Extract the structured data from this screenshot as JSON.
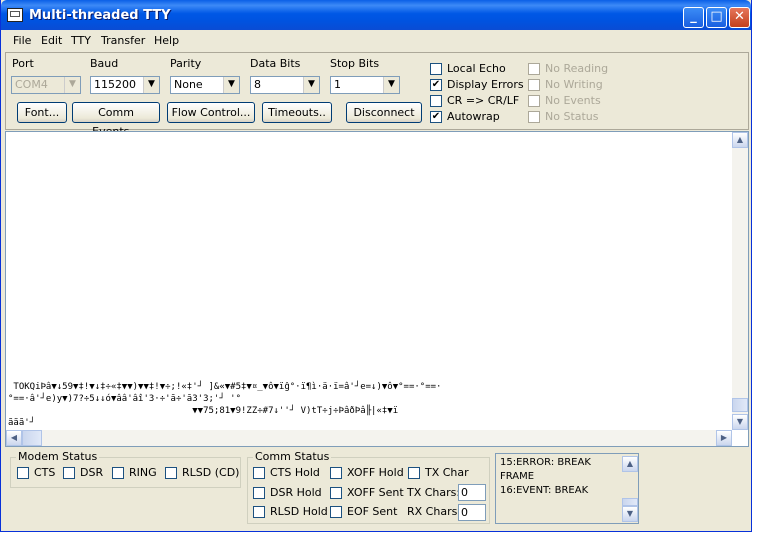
{
  "window": {
    "title": "Multi-threaded TTY",
    "controls": {
      "minimize": "_",
      "maximize": "□",
      "close": "✕"
    }
  },
  "menu": [
    "File",
    "Edit",
    "TTY",
    "Transfer",
    "Help"
  ],
  "settings": {
    "port": {
      "label": "Port",
      "value": "COM4"
    },
    "baud": {
      "label": "Baud",
      "value": "115200"
    },
    "parity": {
      "label": "Parity",
      "value": "None"
    },
    "data_bits": {
      "label": "Data Bits",
      "value": "8"
    },
    "stop_bits": {
      "label": "Stop Bits",
      "value": "1"
    },
    "buttons": {
      "font": "Font...",
      "comm_events": "Comm Events...",
      "flow_control": "Flow Control...",
      "timeouts": "Timeouts..",
      "disconnect": "Disconnect"
    },
    "options": [
      {
        "label": "Local Echo",
        "checked": false,
        "enabled": true
      },
      {
        "label": "Display Errors",
        "checked": true,
        "enabled": true
      },
      {
        "label": "CR => CR/LF",
        "checked": false,
        "enabled": true
      },
      {
        "label": "Autowrap",
        "checked": true,
        "enabled": true
      }
    ],
    "options_disabled": [
      {
        "label": "No Reading",
        "checked": false,
        "enabled": false
      },
      {
        "label": "No Writing",
        "checked": false,
        "enabled": false
      },
      {
        "label": "No Events",
        "checked": false,
        "enabled": false
      },
      {
        "label": "No Status",
        "checked": false,
        "enabled": false
      }
    ]
  },
  "terminal": {
    "lines": [
      " TOKQiÞâ▼↓59▼‡!▼↓‡÷«‡▼▼)▼▼‡!▼÷;!«‡'┘ ]&«▼#5‡▼¤_▼ô▼ïĝ°·ï¶ì·ä·ï=â'┘e=↓)▼ô▼°==·°==·",
      "°==·â'┘e)y▼)7?÷5↓↓ó▼ââ'âî'3·÷'ā÷'ā3'3;'┘ '°",
      "                                  ▼▼75;81▼9!ZZ÷#7↓''┘ V)tT÷j÷ÞâðÞâ╟|«‡▼ï",
      "ããã'┘"
    ]
  },
  "modem_status": {
    "title": "Modem Status",
    "items": [
      {
        "label": "CTS",
        "checked": false
      },
      {
        "label": "DSR",
        "checked": false
      },
      {
        "label": "RING",
        "checked": false
      },
      {
        "label": "RLSD (CD)",
        "checked": false
      }
    ]
  },
  "comm_status": {
    "title": "Comm Status",
    "cts_hold": "CTS Hold",
    "dsr_hold": "DSR Hold",
    "rlsd_hold": "RLSD Hold",
    "xoff_hold": "XOFF Hold",
    "xoff_sent": "XOFF Sent",
    "eof_sent": "EOF Sent",
    "tx_char": "TX Char",
    "tx_chars_label": "TX Chars:",
    "tx_chars_value": "0",
    "rx_chars_label": "RX Chars:",
    "rx_chars_value": "0"
  },
  "event_log": [
    "15:ERROR: BREAK",
    "FRAME",
    "16:EVENT: BREAK"
  ],
  "colors": {
    "titlebar": "#0058e6",
    "window_bg": "#ece9d8",
    "close_button": "#c3401c"
  }
}
